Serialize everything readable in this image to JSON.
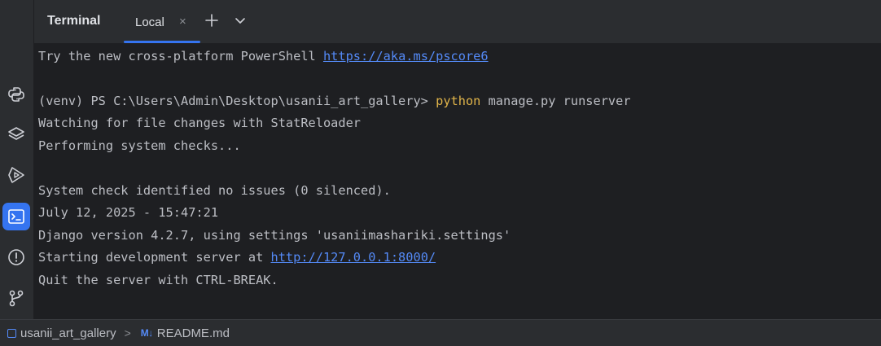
{
  "header": {
    "title": "Terminal",
    "tab_label": "Local",
    "tab_close": "×"
  },
  "left_rail": {
    "icons": [
      "python-icon",
      "layers-icon",
      "services-icon",
      "terminal-icon",
      "problems-icon",
      "git-icon"
    ],
    "active": "terminal-icon"
  },
  "terminal": {
    "line1_text": "Try the new cross-platform PowerShell ",
    "line1_link": "https://aka.ms/pscore6",
    "prompt": "(venv) PS C:\\Users\\Admin\\Desktop\\usanii_art_gallery> ",
    "command": "python",
    "command_args": " manage.py runserver",
    "line_watching": "Watching for file changes with StatReloader",
    "line_checks": "Performing system checks...",
    "line_system_check": "System check identified no issues (0 silenced).",
    "line_date": "July 12, 2025 - 15:47:21",
    "line_django": "Django version 4.2.7, using settings 'usaniimashariki.settings'",
    "line_starting_text": "Starting development server at ",
    "line_starting_link": "http://127.0.0.1:8000/",
    "line_quit": "Quit the server with CTRL-BREAK."
  },
  "status_bar": {
    "project": "usanii_art_gallery",
    "chevron": ">",
    "md_icon": "M↓",
    "file": "README.md"
  },
  "colors": {
    "background": "#1e1f22",
    "panel": "#2b2d30",
    "accent": "#3574f0",
    "link": "#548af7",
    "command": "#e0b44a",
    "text": "#bcbec4"
  }
}
